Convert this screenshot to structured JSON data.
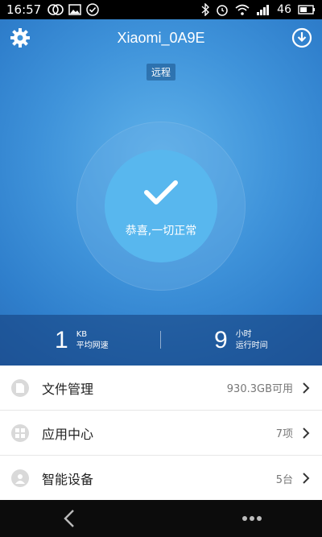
{
  "status_bar": {
    "time": "16:57",
    "battery_level": "46"
  },
  "header": {
    "title": "Xiaomi_0A9E",
    "mode_badge": "远程"
  },
  "status": {
    "message": "恭喜,一切正常"
  },
  "stats": [
    {
      "value": "1",
      "unit": "KB",
      "label": "平均网速"
    },
    {
      "value": "9",
      "unit": "小时",
      "label": "运行时间"
    }
  ],
  "menu": [
    {
      "label": "文件管理",
      "value": "930.3GB可用"
    },
    {
      "label": "应用中心",
      "value": "7项"
    },
    {
      "label": "智能设备",
      "value": "5台"
    }
  ]
}
